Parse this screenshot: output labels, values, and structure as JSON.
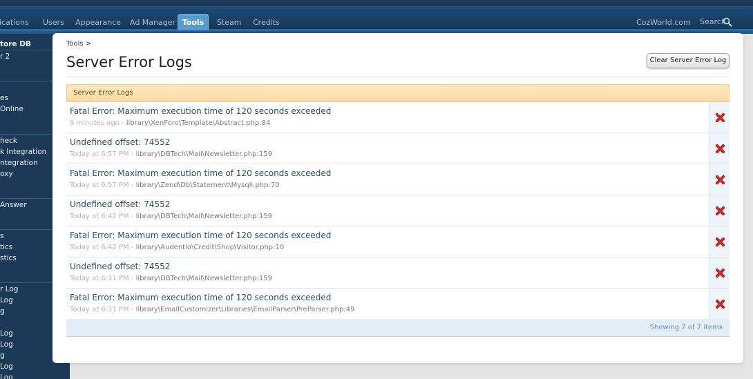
{
  "nav": {
    "tabs": [
      {
        "label": "lications"
      },
      {
        "label": "Users"
      },
      {
        "label": "Appearance"
      },
      {
        "label": "Ad Manager"
      },
      {
        "label": "Tools"
      },
      {
        "label": "Steam"
      },
      {
        "label": "Credits"
      }
    ],
    "active_tab": "Tools",
    "site_link": "CozWorld.com",
    "search_label": "Search"
  },
  "sidebar": {
    "items": [
      "tore DB",
      "r 2",
      "es",
      "Online",
      "heck",
      "k Integration",
      "ntegration",
      "oxy",
      "Answer",
      "s",
      "tics",
      "stics",
      "r Log",
      "Log",
      "g",
      "Log",
      "Log",
      "g",
      "Log",
      "Log"
    ]
  },
  "page": {
    "breadcrumb": "Tools >",
    "title": "Server Error Logs",
    "clear_button": "Clear Server Error Log",
    "list_header": "Server Error Logs",
    "footer": "Showing 7 of 7 items"
  },
  "errors": [
    {
      "message": "Fatal Error: Maximum execution time of 120 seconds exceeded",
      "time": "9 minutes ago",
      "sep": " - ",
      "path": "library\\XenForo\\Template\\Abstract.php:84"
    },
    {
      "message": "Undefined offset: 74552",
      "time": "Today at 6:57 PM",
      "sep": " - ",
      "path": "library\\DBTech\\Mail\\Newsletter.php:159"
    },
    {
      "message": "Fatal Error: Maximum execution time of 120 seconds exceeded",
      "time": "Today at 6:57 PM",
      "sep": " - ",
      "path": "library\\Zend\\Db\\Statement\\Mysqli.php:70"
    },
    {
      "message": "Undefined offset: 74552",
      "time": "Today at 6:42 PM",
      "sep": " - ",
      "path": "library\\DBTech\\Mail\\Newsletter.php:159"
    },
    {
      "message": "Fatal Error: Maximum execution time of 120 seconds exceeded",
      "time": "Today at 6:42 PM",
      "sep": " - ",
      "path": "library\\Audentio\\Credit\\Shop\\Visitor.php:10"
    },
    {
      "message": "Undefined offset: 74552",
      "time": "Today at 6:31 PM",
      "sep": " - ",
      "path": "library\\DBTech\\Mail\\Newsletter.php:159"
    },
    {
      "message": "Fatal Error: Maximum execution time of 120 seconds exceeded",
      "time": "Today at 6:31 PM",
      "sep": " - ",
      "path": "library\\EmailCustomizer\\Libraries\\EmailParser\\PreParser.php:49"
    }
  ],
  "colors": {
    "nav_bg": "#15395b",
    "sidebar_bg": "#1c3a58",
    "list_header_bg": "#fbdaa4",
    "delete_icon": "#d42b2b"
  },
  "icons": {
    "search": "magnifier-icon",
    "delete": "red-x-icon"
  }
}
